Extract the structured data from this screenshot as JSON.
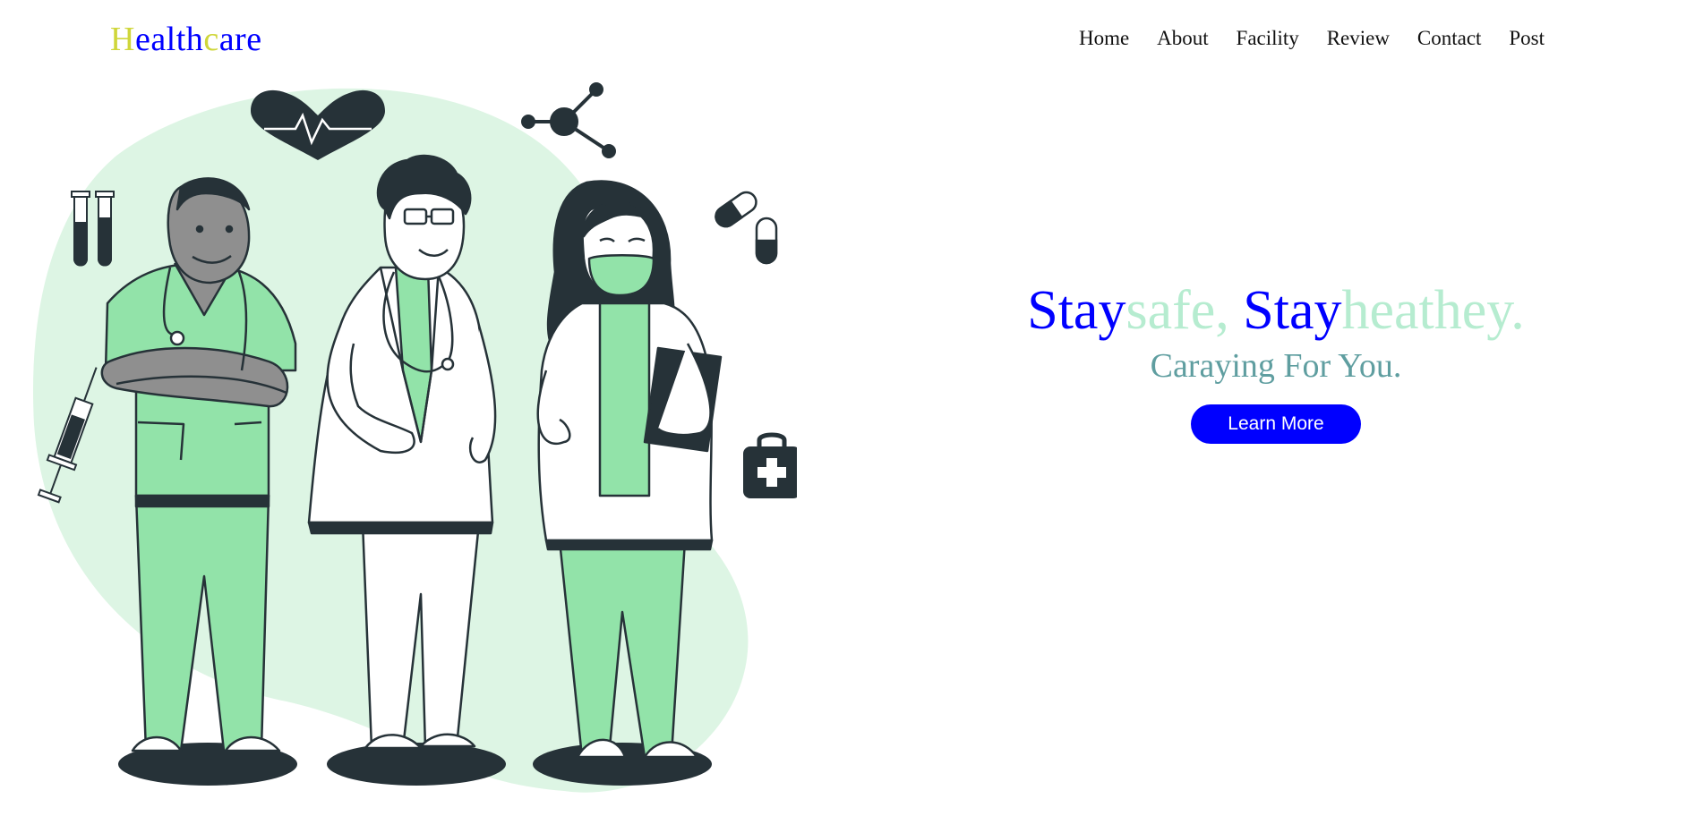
{
  "brand": {
    "logo_parts": [
      "H",
      "ealth",
      "c",
      "are"
    ],
    "colors": {
      "accent": "#cfd63a",
      "primary": "#0000ff"
    }
  },
  "nav": {
    "items": [
      "Home",
      "About",
      "Facility",
      "Review",
      "Contact",
      "Post"
    ]
  },
  "hero": {
    "headline_parts": [
      "Stay",
      "safe, ",
      "Stay",
      "heathey."
    ],
    "headline_colors": {
      "primary": "#0000ff",
      "light": "#b6ecd0"
    },
    "subheadline": "Caraying For You.",
    "subheadline_color": "#5f9ea0",
    "cta_label": "Learn More",
    "cta_color": "#0000ff",
    "cta_text_color": "#ffffff"
  },
  "illustration": {
    "subject": "three medical professionals",
    "icons": [
      "test-tubes-icon",
      "heart-pulse-icon",
      "molecule-icon",
      "pills-icon",
      "syringe-icon",
      "first-aid-kit-icon"
    ],
    "colors": {
      "blob": "#ddf5e4",
      "scrubs": "#92e3a9",
      "outline": "#263238",
      "skin": "#8f8f8f"
    }
  }
}
